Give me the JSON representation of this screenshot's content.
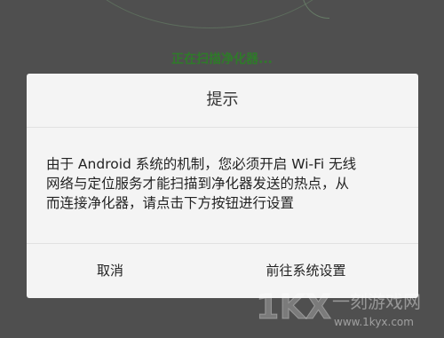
{
  "background": {
    "scan_status": "正在扫描净化器..."
  },
  "dialog": {
    "title": "提示",
    "message_lines": [
      "由于 Android 系统的机制，您必须开启 Wi-Fi 无线",
      "网络与定位服务才能扫描到净化器发送的热点，从",
      "而连接净化器，请点击下方按钮进行设置"
    ],
    "cancel_label": "取消",
    "settings_label": "前往系统设置"
  },
  "watermark": {
    "logo_text": "1KX",
    "site_name": "一刻游戏网",
    "url": "www.1kyx.com"
  },
  "colors": {
    "scan_status": "#2f7a2a",
    "dialog_background": "#f4f4f4",
    "overlay": "#4f4f4f"
  }
}
